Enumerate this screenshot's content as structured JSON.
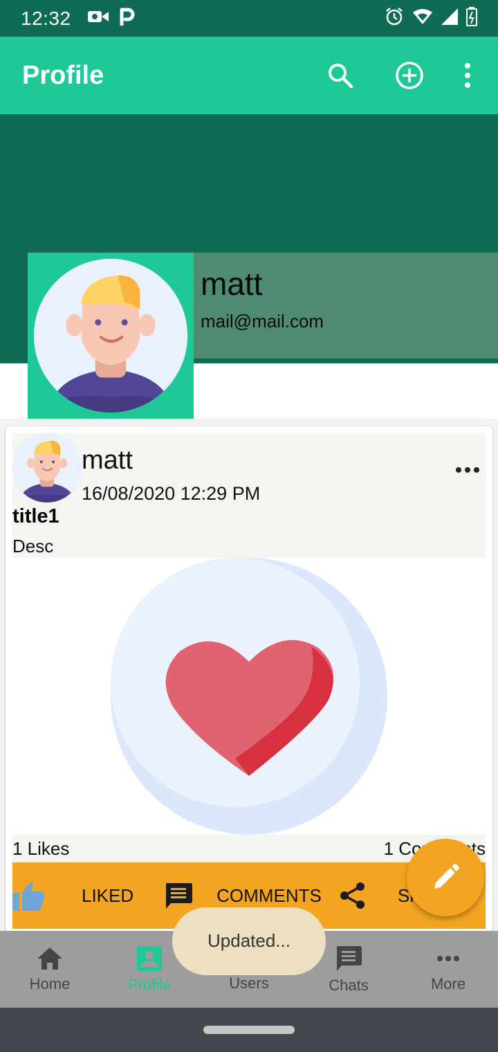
{
  "status_bar": {
    "time": "12:32"
  },
  "app_bar": {
    "title": "Profile"
  },
  "profile": {
    "name": "matt",
    "email": "mail@mail.com"
  },
  "post": {
    "author": "matt",
    "date": "16/08/2020 12:29 PM",
    "title": "title1",
    "description": "Desc",
    "likes": "1 Likes",
    "comments_count": "1 Comments",
    "actions": {
      "like": "LIKED",
      "comment": "COMMENTS",
      "share": "SHARE"
    }
  },
  "toast": "Updated...",
  "bottom_nav": {
    "items": [
      {
        "label": "Home",
        "icon": "home-icon"
      },
      {
        "label": "Profile",
        "icon": "profile-icon"
      },
      {
        "label": "Users",
        "icon": "users-icon"
      },
      {
        "label": "Chats",
        "icon": "chat-icon"
      },
      {
        "label": "More",
        "icon": "more-icon"
      }
    ]
  },
  "colors": {
    "primary": "#1ec997",
    "primary_dark": "#0f6b53",
    "accent": "#f3a521",
    "name_panel": "#4e8b72"
  }
}
